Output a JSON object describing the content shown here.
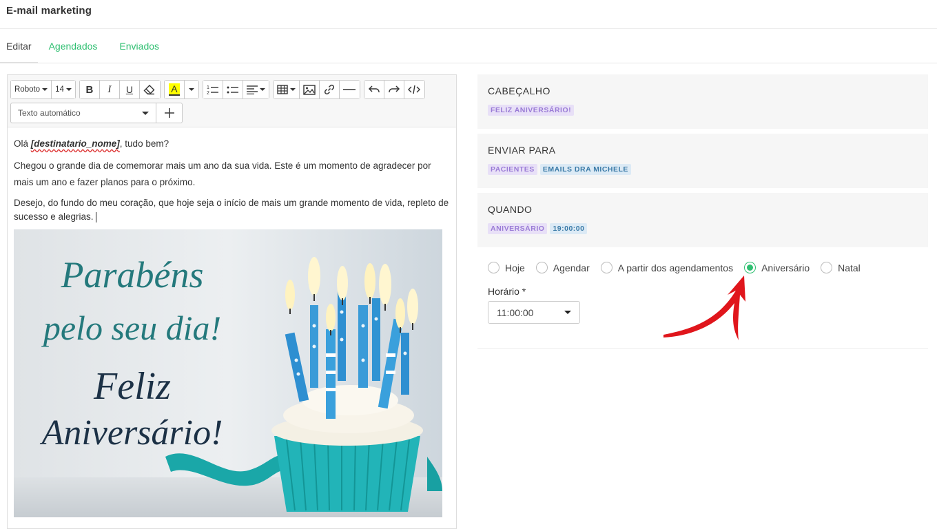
{
  "app": {
    "title": "E-mail marketing"
  },
  "tabs": [
    {
      "label": "Editar",
      "active": true
    },
    {
      "label": "Agendados",
      "active": false
    },
    {
      "label": "Enviados",
      "active": false
    }
  ],
  "toolbar": {
    "font": "Roboto",
    "size": "14",
    "bold": "B",
    "italic": "I",
    "underline": "U",
    "highlight": "A",
    "auto_text": "Texto automático"
  },
  "message": {
    "greeting_prefix": "Olá ",
    "variable": "[destinatario_nome]",
    "greeting_suffix": ", tudo bem?",
    "p1": "Chegou o grande dia de comemorar mais um ano da sua vida. Este é um momento de agradecer por mais um ano e fazer planos para o próximo.",
    "p2": "Desejo, do fundo do meu coração, que hoje seja o início de mais um grande momento de vida, repleto de sucesso e alegrias."
  },
  "card": {
    "line1": "Parabéns",
    "line2": "pelo seu dia!",
    "line3": "Feliz",
    "line4": "Aniversário!"
  },
  "panels": {
    "header": {
      "title": "CABEÇALHO",
      "tags": [
        "FELIZ ANIVERSÁRIO!"
      ]
    },
    "send_to": {
      "title": "ENVIAR PARA",
      "tags": [
        "PACIENTES",
        "EMAILS DRA MICHELE"
      ]
    },
    "when": {
      "title": "QUANDO",
      "tags": [
        "ANIVERSÁRIO",
        "19:00:00"
      ]
    }
  },
  "schedule": {
    "options": [
      {
        "label": "Hoje",
        "selected": false
      },
      {
        "label": "Agendar",
        "selected": false
      },
      {
        "label": "A partir dos agendamentos",
        "selected": false
      },
      {
        "label": "Aniversário",
        "selected": true
      },
      {
        "label": "Natal",
        "selected": false
      }
    ],
    "time_label": "Horário *",
    "time_value": "11:00:00"
  },
  "colors": {
    "accent": "#2fbf71",
    "arrow": "#e0161c"
  }
}
